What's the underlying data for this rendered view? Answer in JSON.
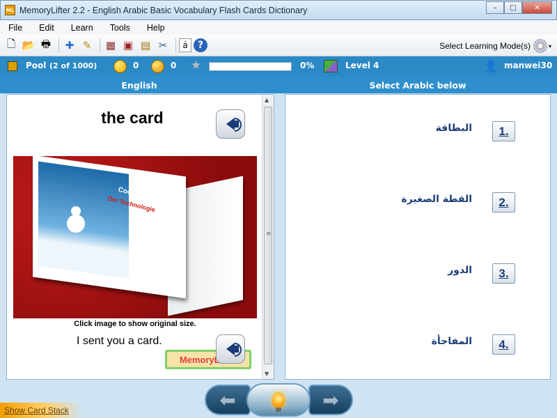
{
  "window": {
    "title": "MemoryLifter 2.2 - English Arabic Basic Vocabulary Flash Cards Dictionary",
    "app_icon_label": "ML",
    "min_glyph": "–",
    "max_glyph": "□",
    "close_glyph": "✕"
  },
  "menu": {
    "items": [
      "File",
      "Edit",
      "Learn",
      "Tools",
      "Help"
    ]
  },
  "toolbar": {
    "mode_label": "Select Learning Mode(s)",
    "mode_chevron": "▾",
    "icons": [
      "new-document-icon",
      "open-folder-icon",
      "print-icon",
      "add-card-icon",
      "edit-card-icon",
      "presentation-icon",
      "slideshow-icon",
      "dictionary-icon",
      "settings-tools-icon",
      "character-map-icon",
      "help-icon"
    ],
    "glyphs": {
      "new": "🗋",
      "open": "📂",
      "print": "🖶",
      "add": "✚",
      "edit": "✎",
      "present": "▦",
      "slideshow": "▣",
      "dictionary": "▤",
      "tools": "✂",
      "charmap": "á",
      "help": "?"
    }
  },
  "status": {
    "pool_label": "Pool",
    "pool_count": "(2 of 1000)",
    "correct_count": "0",
    "wrong_count": "0",
    "progress_percent": 0,
    "progress_text": "0%",
    "level": "Level 4",
    "user": "manwei30",
    "star_glyph": "★",
    "user_glyph": "👤"
  },
  "left_header": "English",
  "right_header": "Select Arabic below",
  "question": {
    "word": "the card",
    "image_caption": "Click image to show original size.",
    "image_headline": "Cool Testing",
    "image_subhead": "Der Technologie",
    "example_sentence": "I sent you a card.",
    "watermark_text": "MemoryLifter"
  },
  "scrollbar": {
    "up_arrow": "▲",
    "down_arrow": "▼",
    "grip": "≡"
  },
  "answers": [
    {
      "number": "1.",
      "text": "البطاقة"
    },
    {
      "number": "2.",
      "text": "القطة الصغيرة"
    },
    {
      "number": "3.",
      "text": "الدور"
    },
    {
      "number": "4.",
      "text": "المفاجأة"
    }
  ],
  "nav": {
    "prev_glyph": "⬅",
    "next_glyph": "➡"
  },
  "footer": {
    "card_stack_link": "Show Card Stack"
  },
  "colors": {
    "accent_blue": "#2b89c6",
    "answer_text": "#1d3d78",
    "progress_fill": "#78c44b"
  }
}
